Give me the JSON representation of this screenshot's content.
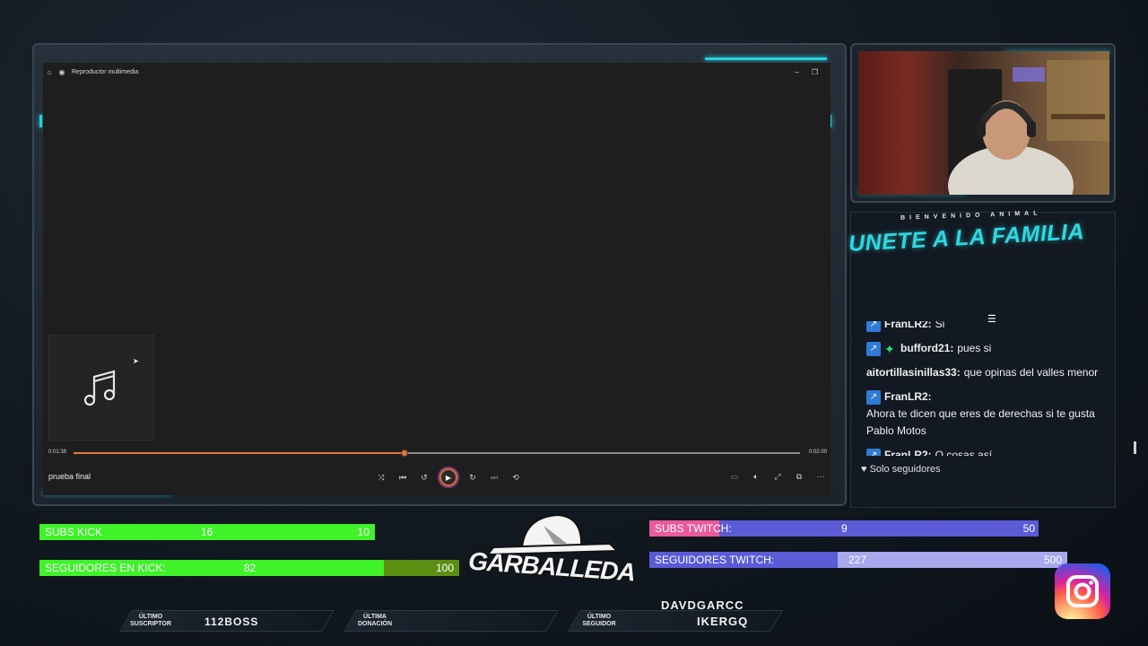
{
  "player": {
    "window_title": "Reproductor multimedia",
    "track_title": "prueba final",
    "elapsed": "0:01:38",
    "total": "0:02:00",
    "progress": 0.455
  },
  "chat": {
    "welcome": "BIENVENIDO ANIMAL",
    "headline": "UNETE A LA FAMILIA",
    "messages": [
      {
        "user": "FranLR2:",
        "text": "Si",
        "badge": "kick"
      },
      {
        "user": "bufford21:",
        "text": "pues si",
        "badge": "gem"
      },
      {
        "user": "aitortillasinillas33:",
        "text": "que opinas del valles menor",
        "badge": ""
      },
      {
        "user": "FranLR2:",
        "text": "Ahora te dicen que eres de derechas si te gusta Pablo Motos",
        "badge": "kick"
      },
      {
        "user": "FranLR2:",
        "text": "O cosas así",
        "badge": "kick"
      }
    ],
    "footer": "Solo seguidores"
  },
  "goals": {
    "subs_kick": {
      "label": "SUBS KICK",
      "value": "16",
      "target": "10",
      "fill": 1.0
    },
    "seguidores_kick": {
      "label": "SEGUIDORES EN KICK:",
      "value": "82",
      "target": "100",
      "fill": 0.82
    },
    "subs_twitch": {
      "label": "SUBS TWITCH:",
      "value": "9",
      "target": "50",
      "fill": 0.18
    },
    "seguidores_twitch": {
      "label": "SEGUIDORES TWITCH:",
      "value": "227",
      "target": "500",
      "fill": 0.45
    }
  },
  "logo": {
    "text": "GARBALLEDA"
  },
  "bottom": {
    "suscriptor_label_1": "ÚLTIMO",
    "suscriptor_label_2": "SUSCRIPTOR",
    "suscriptor_value": "112BOSS",
    "donacion_label_1": "ÚLTIMA",
    "donacion_label_2": "DONACIÓN",
    "donacion_value": "",
    "seguidor_label_1": "ÚLTIMO",
    "seguidor_label_2": "SEGUIDOR",
    "seguidor_value_1": "DAVDGARCC",
    "seguidor_value_2": "IKERGQ"
  },
  "colors": {
    "accent": "#23d3dc",
    "kick_green": "#3ff22a",
    "kick_dark_green": "#5a8f14",
    "twitch_purple": "#5b5bd6",
    "twitch_light": "#a8a8ec",
    "twitch_pink": "#e85a9b",
    "player_orange": "#e07a3e"
  },
  "icons": [
    "home-icon",
    "media-player-icon",
    "music-note-icon",
    "shuffle-icon",
    "previous-icon",
    "rewind-icon",
    "play-icon",
    "forward-icon",
    "next-icon",
    "repeat-icon",
    "kick-badge-icon",
    "heart-icon",
    "instagram-icon"
  ]
}
